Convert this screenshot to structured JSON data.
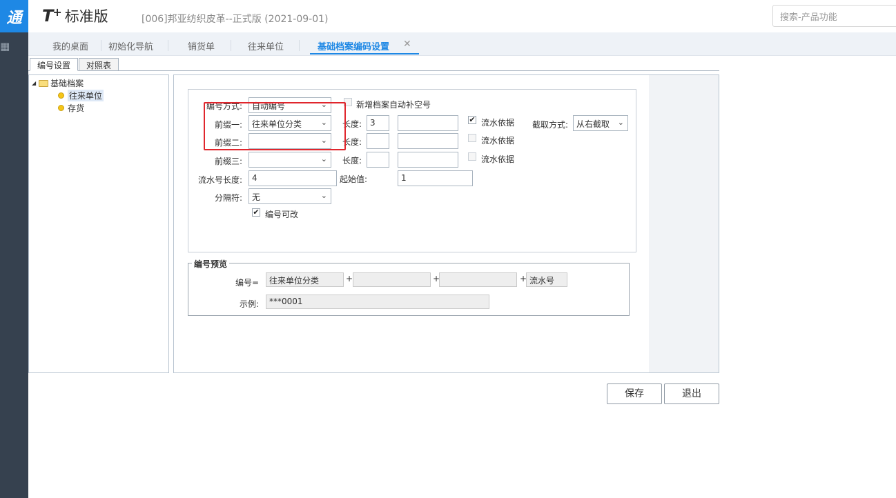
{
  "rail": {
    "logo": "通",
    "icon": "grid-icon"
  },
  "header": {
    "brand_t": "T",
    "brand_plus": "+",
    "brand_name": "标准版",
    "account": "[006]邦亚纺织皮革--正式版  (2021-09-01)",
    "search_placeholder": "搜索-产品功能"
  },
  "tabs": [
    {
      "label": "我的桌面"
    },
    {
      "label": "初始化导航"
    },
    {
      "label": "销货单"
    },
    {
      "label": "往来单位"
    },
    {
      "label": "基础档案编码设置",
      "active": true
    }
  ],
  "tab_close": "✕",
  "subtabs": [
    "编号设置",
    "对照表"
  ],
  "tree": {
    "root": "基础档案",
    "children": [
      "往来单位",
      "存货"
    ]
  },
  "form": {
    "mode_label": "编号方式:",
    "mode_value": "自动编号",
    "autofill_label": "新增档案自动补空号",
    "prefix1_label": "前缀一:",
    "prefix1_value": "往来单位分类",
    "prefix2_label": "前缀二:",
    "prefix2_value": "",
    "prefix3_label": "前缀三:",
    "prefix3_value": "",
    "length_label": "长度:",
    "length1": "3",
    "length2": "",
    "length3": "",
    "serial_basis_label": "流水依据",
    "serial_basis_checked": [
      true,
      false,
      false
    ],
    "cut_label": "截取方式:",
    "cut_value": "从右截取",
    "serial_length_label": "流水号长度:",
    "serial_length": "4",
    "start_label": "起始值:",
    "start_value": "1",
    "separator_label": "分隔符:",
    "separator_value": "无",
    "editable_label": "编号可改",
    "editable_checked": true
  },
  "preview": {
    "title": "编号预览",
    "code_label": "编号=",
    "part1": "往来单位分类",
    "part2": "",
    "part3": "",
    "part4": "流水号",
    "plus": "+",
    "example_label": "示例:",
    "example_value": "***0001"
  },
  "buttons": {
    "save": "保存",
    "exit": "退出"
  },
  "colors": {
    "accent": "#1e88e5",
    "rail": "#36414f",
    "highlight": "#e0262d"
  }
}
